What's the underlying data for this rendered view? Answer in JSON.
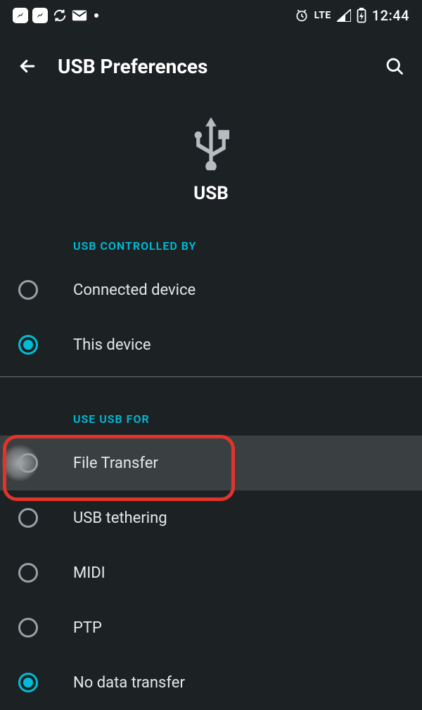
{
  "status_bar": {
    "network_label": "LTE",
    "time": "12:44"
  },
  "app_bar": {
    "title": "USB Preferences"
  },
  "hero": {
    "label": "USB"
  },
  "sections": {
    "controlled_by": {
      "header": "USB CONTROLLED BY",
      "options": {
        "connected_device": {
          "label": "Connected device",
          "selected": false
        },
        "this_device": {
          "label": "This device",
          "selected": true
        }
      }
    },
    "use_usb_for": {
      "header": "USE USB FOR",
      "options": {
        "file_transfer": {
          "label": "File Transfer",
          "selected": false,
          "highlighted": true
        },
        "usb_tethering": {
          "label": "USB tethering",
          "selected": false
        },
        "midi": {
          "label": "MIDI",
          "selected": false
        },
        "ptp": {
          "label": "PTP",
          "selected": false
        },
        "no_data_transfer": {
          "label": "No data transfer",
          "selected": true
        }
      }
    }
  }
}
